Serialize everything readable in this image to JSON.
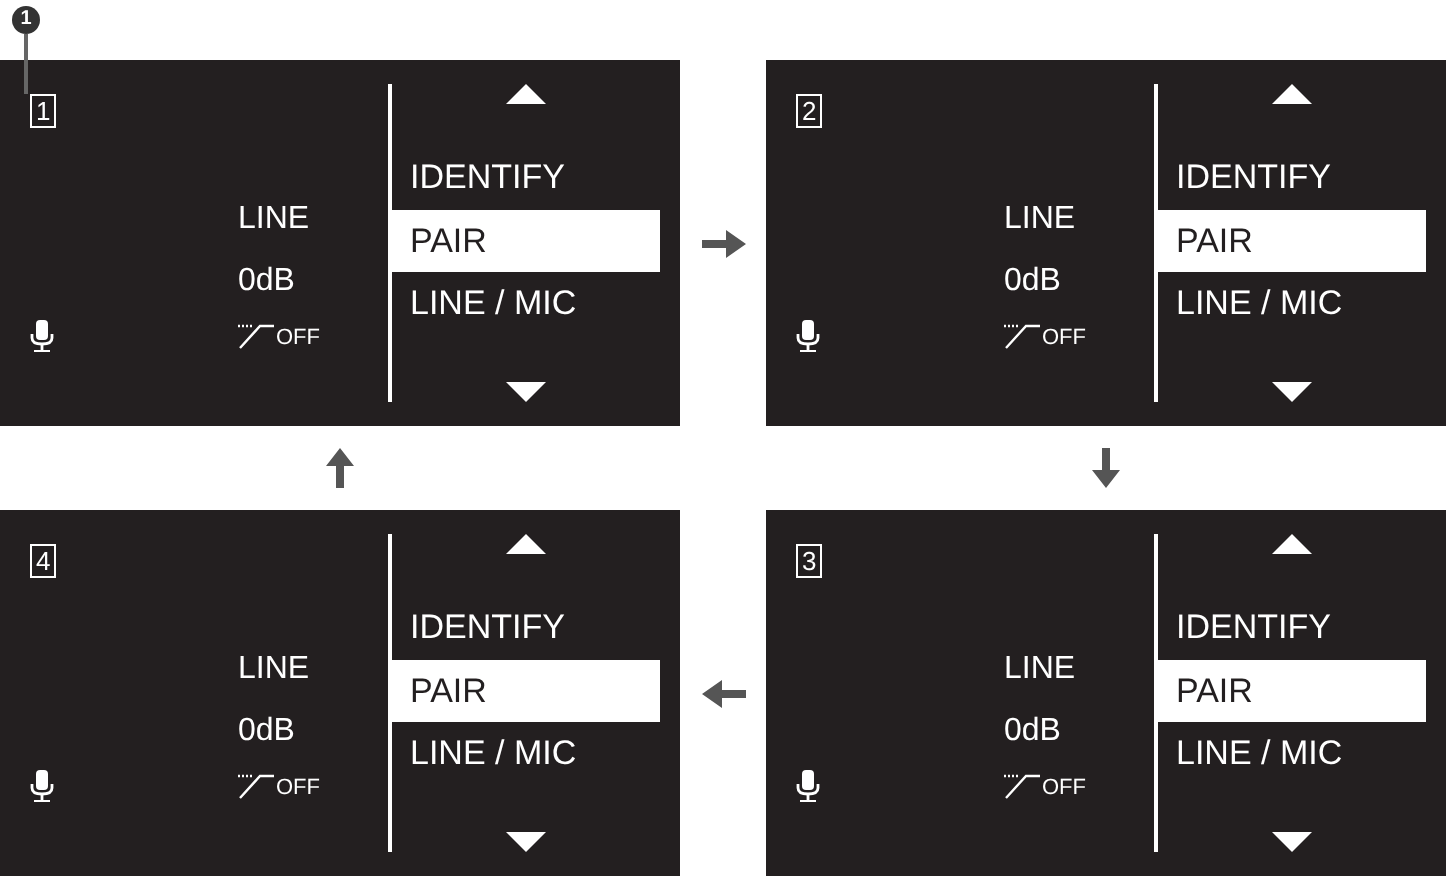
{
  "callout": {
    "label": "1"
  },
  "screens": [
    {
      "number": "1",
      "input_mode": "LINE",
      "gain": "0dB",
      "low_cut": "OFF",
      "menu": [
        {
          "label": "IDENTIFY",
          "selected": false
        },
        {
          "label": "PAIR",
          "selected": true
        },
        {
          "label": "LINE / MIC",
          "selected": false
        }
      ]
    },
    {
      "number": "2",
      "input_mode": "LINE",
      "gain": "0dB",
      "low_cut": "OFF",
      "menu": [
        {
          "label": "IDENTIFY",
          "selected": false
        },
        {
          "label": "PAIR",
          "selected": true
        },
        {
          "label": "LINE / MIC",
          "selected": false
        }
      ]
    },
    {
      "number": "4",
      "input_mode": "LINE",
      "gain": "0dB",
      "low_cut": "OFF",
      "menu": [
        {
          "label": "IDENTIFY",
          "selected": false
        },
        {
          "label": "PAIR",
          "selected": true
        },
        {
          "label": "LINE / MIC",
          "selected": false
        }
      ]
    },
    {
      "number": "3",
      "input_mode": "LINE",
      "gain": "0dB",
      "low_cut": "OFF",
      "menu": [
        {
          "label": "IDENTIFY",
          "selected": false
        },
        {
          "label": "PAIR",
          "selected": true
        },
        {
          "label": "LINE / MIC",
          "selected": false
        }
      ]
    }
  ],
  "arrows": [
    {
      "kind": "right"
    },
    {
      "kind": "up"
    },
    {
      "kind": "down"
    },
    {
      "kind": "left"
    }
  ]
}
